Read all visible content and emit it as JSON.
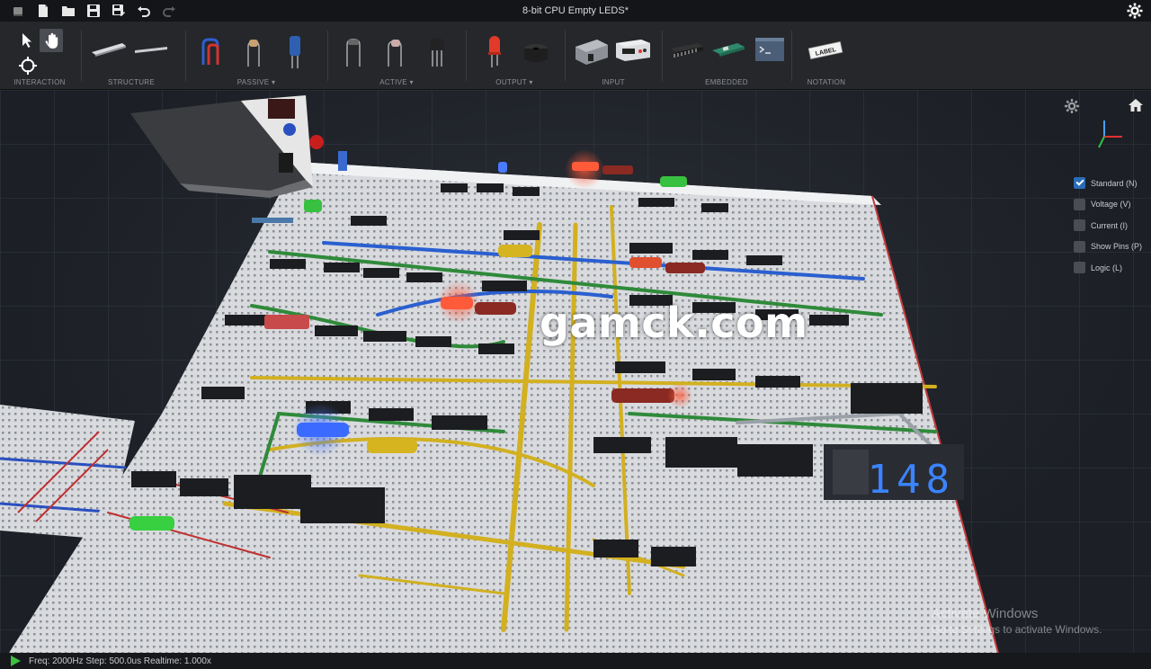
{
  "window": {
    "title": "8-bit CPU Empty LEDS*"
  },
  "titlebar": {
    "buttons": [
      "new-file-icon",
      "open-folder-icon",
      "save-icon",
      "save-as-icon",
      "undo-icon",
      "redo-icon"
    ],
    "settings_icon": "gear-icon"
  },
  "toolbar": {
    "groups": [
      {
        "label": "INTERACTION",
        "tools": [
          "select-arrow-icon",
          "hand-pan-icon",
          "crosshair-icon"
        ],
        "active": "hand-pan-icon"
      },
      {
        "label": "STRUCTURE",
        "tools": [
          "breadboard-icon",
          "wire-strip-icon"
        ]
      },
      {
        "label": "PASSIVE",
        "dropdown": true,
        "tools": [
          "wire-icon",
          "resistor-icon",
          "capacitor-icon"
        ]
      },
      {
        "label": "ACTIVE",
        "dropdown": true,
        "tools": [
          "diode-icon",
          "resistor-lead-icon",
          "transistor-icon"
        ]
      },
      {
        "label": "OUTPUT",
        "dropdown": true,
        "tools": [
          "led-icon",
          "buzzer-icon"
        ]
      },
      {
        "label": "INPUT",
        "tools": [
          "switch-icon",
          "power-supply-icon"
        ]
      },
      {
        "label": "EMBEDDED",
        "tools": [
          "ic-chip-icon",
          "microcontroller-icon",
          "terminal-icon"
        ]
      },
      {
        "label": "NOTATION",
        "tools": [
          "label-tag-icon"
        ],
        "tag_text": "LABEL"
      }
    ]
  },
  "viewport": {
    "watermark": "gamck.com",
    "display_digits": "148",
    "activation": {
      "line1": "Activate Windows",
      "line2": "Go to Settings to activate Windows."
    },
    "view_toggles": [
      {
        "label": "Standard (N)",
        "checked": true
      },
      {
        "label": "Voltage (V)",
        "checked": false
      },
      {
        "label": "Current (I)",
        "checked": false
      },
      {
        "label": "Show Pins (P)",
        "checked": false
      },
      {
        "label": "Logic (L)",
        "checked": false
      }
    ],
    "icons": {
      "settings": "gear-icon",
      "home": "home-icon",
      "axes": "axis-gizmo-icon"
    }
  },
  "statusbar": {
    "text": "Freq: 2000Hz  Step: 500.0us Realtime: 1.000x",
    "play_icon": "play-icon"
  },
  "colors": {
    "accent": "#2a6cb8",
    "background": "#1b1d22",
    "toolbar": "#25272b"
  }
}
